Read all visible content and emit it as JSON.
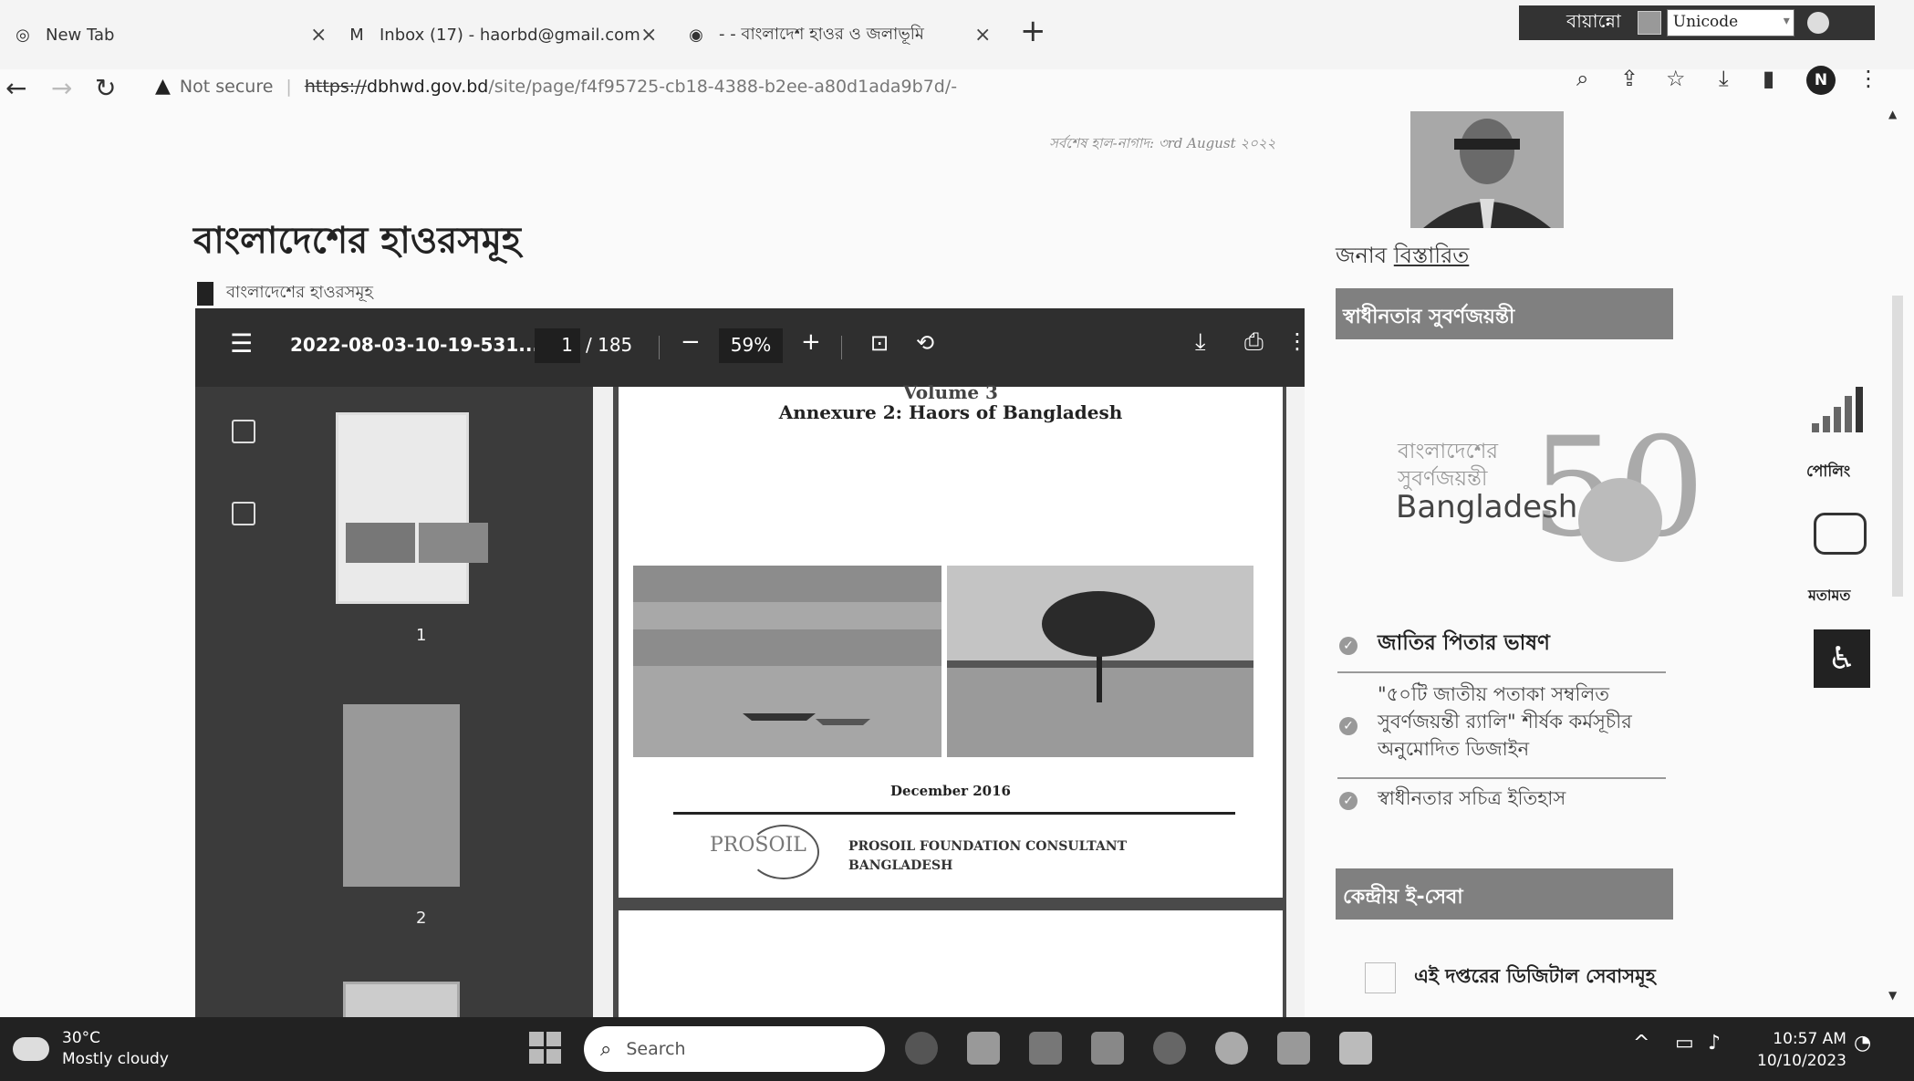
{
  "browser": {
    "tabs": [
      {
        "title": "New Tab",
        "icon": "chrome-icon"
      },
      {
        "title": "Inbox (17) - haorbd@gmail.com",
        "icon": "gmail-icon"
      },
      {
        "title": "- - বাংলাদেশ হাওর ও জলাভূমি",
        "icon": "site-icon"
      }
    ],
    "new_tab_symbol": "+",
    "close_symbol": "×",
    "security_label": "Not secure",
    "url_protocol": "https://",
    "url_host": "dbhwd.gov.bd",
    "url_path": "/site/page/f4f95725-cb18-4388-b2ee-a80d1ada9b7d/-",
    "profile_initial": "N"
  },
  "extension": {
    "language_label": "বায়ান্নো",
    "encoding_value": "Unicode"
  },
  "page": {
    "date_text": "সর্বশেষ হাল-নাগাদ: ৩rd August ২০২২",
    "title": "বাংলাদেশের হাওরসমূহ",
    "attachment_label": "বাংলাদেশের হাওরসমূহ"
  },
  "pdf_viewer": {
    "filename": "2022-08-03-10-19-531...",
    "current_page": "1",
    "total_pages": "/ 185",
    "zoom": "59%",
    "thumb_labels": [
      "1",
      "2"
    ],
    "doc_volume": "Volume 3",
    "doc_title": "Annexure 2: Haors of Bangladesh",
    "doc_date": "December 2016",
    "doc_logo": "PROSOIL",
    "doc_company_line1": "PROSOIL FOUNDATION CONSULTANT",
    "doc_company_line2": "BANGLADESH"
  },
  "sidebar": {
    "person_caption_prefix": "জনাব",
    "person_link": "বিস্তারিত",
    "banner_golden": "স্বাধীনতার সুবর্ণজয়ন্তী",
    "logo_bn_line1": "বাংলাদেশের",
    "logo_bn_line2": "সুবর্ণজয়ন্তী",
    "logo_en": "Bangladesh",
    "logo_number": "50",
    "links": [
      "জাতির পিতার ভাষণ",
      "\"৫০টি জাতীয় পতাকা সম্বলিত সুবর্ণজয়ন্তী র‍্যালি\" শীর্ষক কর্মসূচীর অনুমোদিত ডিজাইন",
      "স্বাধীনতার সচিত্র ইতিহাস"
    ],
    "banner_eservice": "কেন্দ্রীয় ই-সেবা",
    "digital_services": "এই দপ্তরের ডিজিটাল সেবাসমূহ"
  },
  "floating": {
    "poll_label": "পোলিং",
    "feedback_label": "মতামত"
  },
  "taskbar": {
    "temperature": "30°C",
    "weather": "Mostly cloudy",
    "search_placeholder": "Search",
    "time": "10:57 AM",
    "date": "10/10/2023"
  }
}
